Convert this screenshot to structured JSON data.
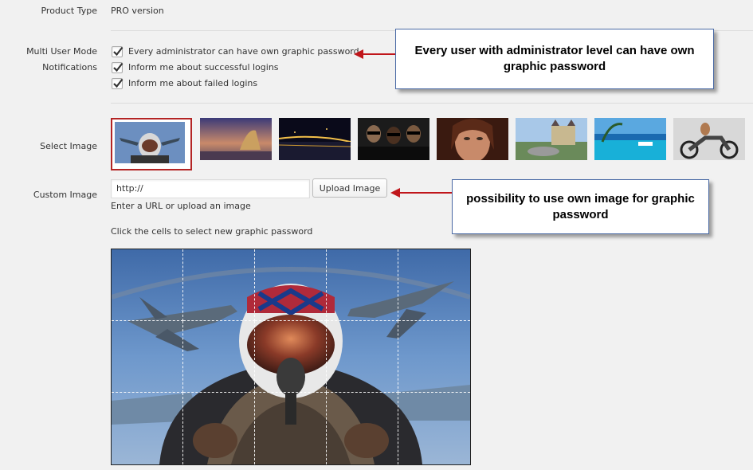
{
  "product_type": {
    "label": "Product Type",
    "value": "PRO version"
  },
  "multi_user": {
    "label": "Multi User Mode",
    "option": {
      "label": "Every administrator can have own graphic password",
      "checked": true
    }
  },
  "notifications": {
    "label": "Notifications",
    "options": [
      {
        "label": "Inform me about successful logins",
        "checked": true
      },
      {
        "label": "Inform me about failed logins",
        "checked": true
      }
    ]
  },
  "select_image": {
    "label": "Select Image",
    "thumbnails": [
      {
        "name": "jet-pilot",
        "selected": true
      },
      {
        "name": "cheetah-sunset",
        "selected": false
      },
      {
        "name": "night-bridge",
        "selected": false
      },
      {
        "name": "men-in-black",
        "selected": false
      },
      {
        "name": "woman-portrait",
        "selected": false
      },
      {
        "name": "castle-car",
        "selected": false
      },
      {
        "name": "tropical-sea",
        "selected": false
      },
      {
        "name": "motorcycle-girl",
        "selected": false
      }
    ]
  },
  "custom_image": {
    "label": "Custom Image",
    "url_value": "http://",
    "upload_label": "Upload Image",
    "hint": "Enter a URL or upload an image"
  },
  "grid": {
    "instruction": "Click the cells to select new graphic password",
    "rows": 3,
    "cols": 5
  },
  "callouts": {
    "admin": "Every user with administrator level can have own graphic password",
    "custom": "possibility to use own image for graphic password"
  },
  "colors": {
    "selected_border": "#b32424",
    "arrow": "#c0161b",
    "callout_border": "#4a6aa5"
  }
}
